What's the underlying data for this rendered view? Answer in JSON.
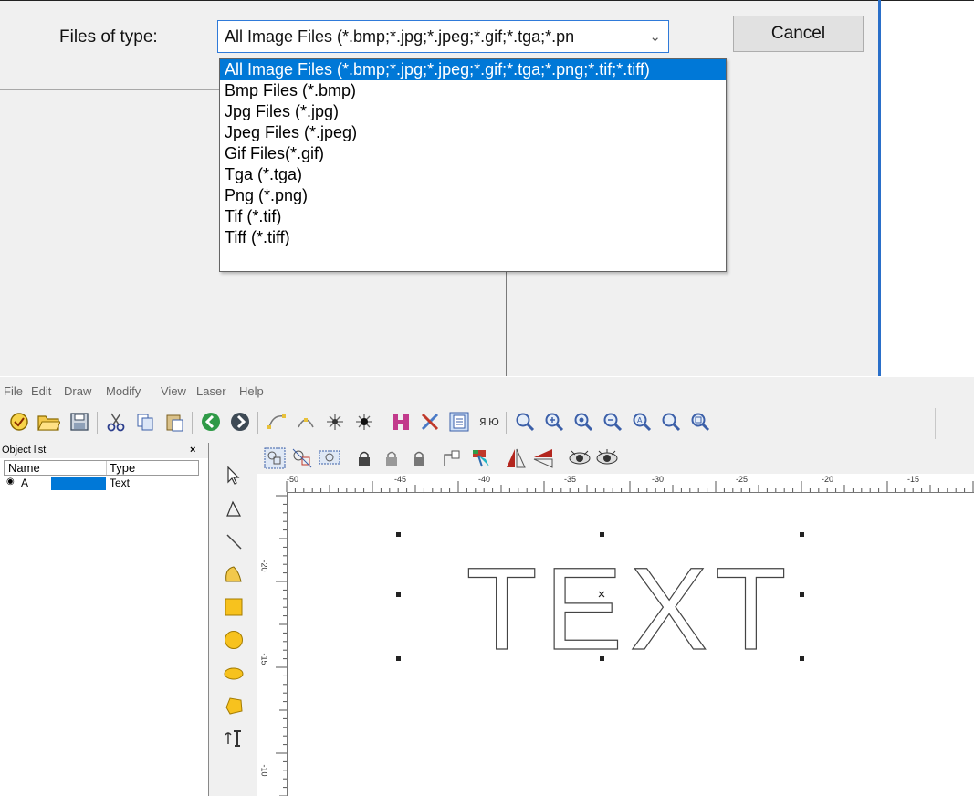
{
  "dialog": {
    "files_of_type_label": "Files of type:",
    "combo_value": "All Image Files (*.bmp;*.jpg;*.jpeg;*.gif;*.tga;*.pn",
    "cancel_label": "Cancel",
    "type_options": [
      "All Image Files (*.bmp;*.jpg;*.jpeg;*.gif;*.tga;*.png;*.tif;*.tiff)",
      "Bmp Files (*.bmp)",
      "Jpg Files (*.jpg)",
      "Jpeg Files (*.jpeg)",
      "Gif Files(*.gif)",
      "Tga (*.tga)",
      "Png (*.png)",
      "Tif (*.tif)",
      "Tiff (*.tiff)"
    ],
    "selected_index": 0
  },
  "menu": [
    "File",
    "Edit",
    "Draw",
    "Modify",
    "View",
    "Laser",
    "Help"
  ],
  "toolbar1_icons": [
    "wizard-icon",
    "open-folder-icon",
    "save-icon",
    "cut-icon",
    "copy-icon",
    "paste-icon",
    "back-icon",
    "forward-icon",
    "node-edit-icon",
    "node-select-icon",
    "node-join-icon",
    "node-break-icon",
    "hatch-icon",
    "tools-icon",
    "parameter-icon",
    "distribute-icon",
    "zoom-icon",
    "zoom-in-icon",
    "zoom-in-2-icon",
    "zoom-out-icon",
    "zoom-fit-icon",
    "zoom-all-icon",
    "zoom-select-icon"
  ],
  "object_list": {
    "title": "Object list",
    "close": "×",
    "col_name": "Name",
    "col_type": "Type",
    "rows": [
      {
        "name": "A",
        "type": "Text"
      }
    ]
  },
  "draw_tools": [
    "select-arrow-icon",
    "node-edit-tool-icon",
    "line-tool-icon",
    "curve-tool-icon",
    "rectangle-tool-icon",
    "circle-tool-icon",
    "ellipse-tool-icon",
    "polygon-tool-icon",
    "text-tool-icon"
  ],
  "toolbar2_icons": [
    "group-icon",
    "ungroup-icon",
    "combine-icon",
    "lock-icon",
    "unlock-icon",
    "unlock-all-icon",
    "align-icon",
    "color-icon",
    "mirror-horizontal-icon",
    "mirror-vertical-icon",
    "view-icon",
    "view-all-icon"
  ],
  "rulers": {
    "h_labels": [
      "-50",
      "-45",
      "-40",
      "-35",
      "-30",
      "-25",
      "-20",
      "-15"
    ],
    "v_labels": [
      "-20",
      "-15",
      "-10"
    ]
  },
  "canvas_text": "TEXT",
  "colors": {
    "selection": "#0078d7",
    "dialog_bg": "#f0f0f0",
    "accent_border": "#2a6fc9"
  }
}
